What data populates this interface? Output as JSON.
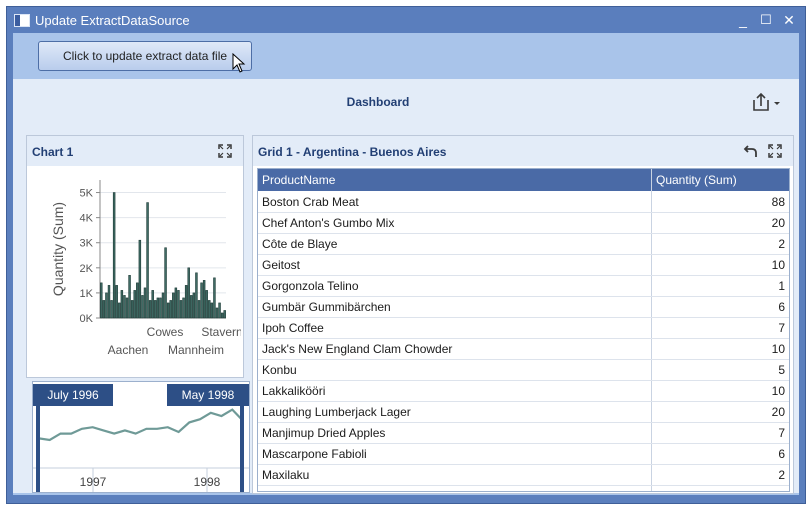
{
  "window": {
    "title": "Update ExtractDataSource",
    "minimize": "_",
    "maximize": "☐",
    "close": "✕"
  },
  "ribbon": {
    "update_label": "Click to update extract data file"
  },
  "dashboard": {
    "title": "Dashboard"
  },
  "chart_panel": {
    "title": "Chart 1"
  },
  "grid_panel": {
    "title": "Grid 1 - Argentina - Buenos Aires"
  },
  "chart_data": {
    "type": "bar",
    "ylabel": "Quantity (Sum)",
    "yticks": [
      "0K",
      "1K",
      "2K",
      "3K",
      "4K",
      "5K"
    ],
    "ylim": [
      0,
      5500
    ],
    "xticks_row1": [
      "Cowes",
      "Stavern"
    ],
    "xticks_row2": [
      "Aachen",
      "Mannheim"
    ],
    "values": [
      1400,
      700,
      1000,
      1300,
      700,
      5000,
      1300,
      600,
      1100,
      900,
      800,
      1700,
      700,
      1100,
      1400,
      3100,
      900,
      1200,
      4600,
      700,
      1100,
      700,
      800,
      800,
      1000,
      2800,
      600,
      700,
      1000,
      1200,
      1100,
      700,
      800,
      1300,
      2000,
      900,
      1000,
      1800,
      700,
      1400,
      1500,
      1100,
      700,
      600,
      1600,
      400,
      600,
      200,
      300
    ]
  },
  "timeline": {
    "start": "July 1996",
    "end": "May 1998",
    "years": [
      "1997",
      "1998"
    ],
    "values": [
      1100,
      1000,
      1400,
      1400,
      1700,
      1800,
      1600,
      1400,
      1600,
      1400,
      1700,
      1700,
      1800,
      1500,
      2100,
      2300,
      2700,
      2500,
      2900,
      2200
    ]
  },
  "grid": {
    "columns": [
      "ProductName",
      "Quantity (Sum)"
    ],
    "rows": [
      {
        "name": "Boston Crab Meat",
        "qty": "88"
      },
      {
        "name": "Chef Anton's Gumbo Mix",
        "qty": "20"
      },
      {
        "name": "Côte de Blaye",
        "qty": "2"
      },
      {
        "name": "Geitost",
        "qty": "10"
      },
      {
        "name": "Gorgonzola Telino",
        "qty": "1"
      },
      {
        "name": "Gumbär Gummibärchen",
        "qty": "6"
      },
      {
        "name": "Ipoh Coffee",
        "qty": "7"
      },
      {
        "name": "Jack's New England Clam Chowder",
        "qty": "10"
      },
      {
        "name": "Konbu",
        "qty": "5"
      },
      {
        "name": "Lakkalikööri",
        "qty": "10"
      },
      {
        "name": "Laughing Lumberjack Lager",
        "qty": "20"
      },
      {
        "name": "Manjimup Dried Apples",
        "qty": "7"
      },
      {
        "name": "Mascarpone Fabioli",
        "qty": "6"
      },
      {
        "name": "Maxilaku",
        "qty": "2"
      }
    ]
  }
}
